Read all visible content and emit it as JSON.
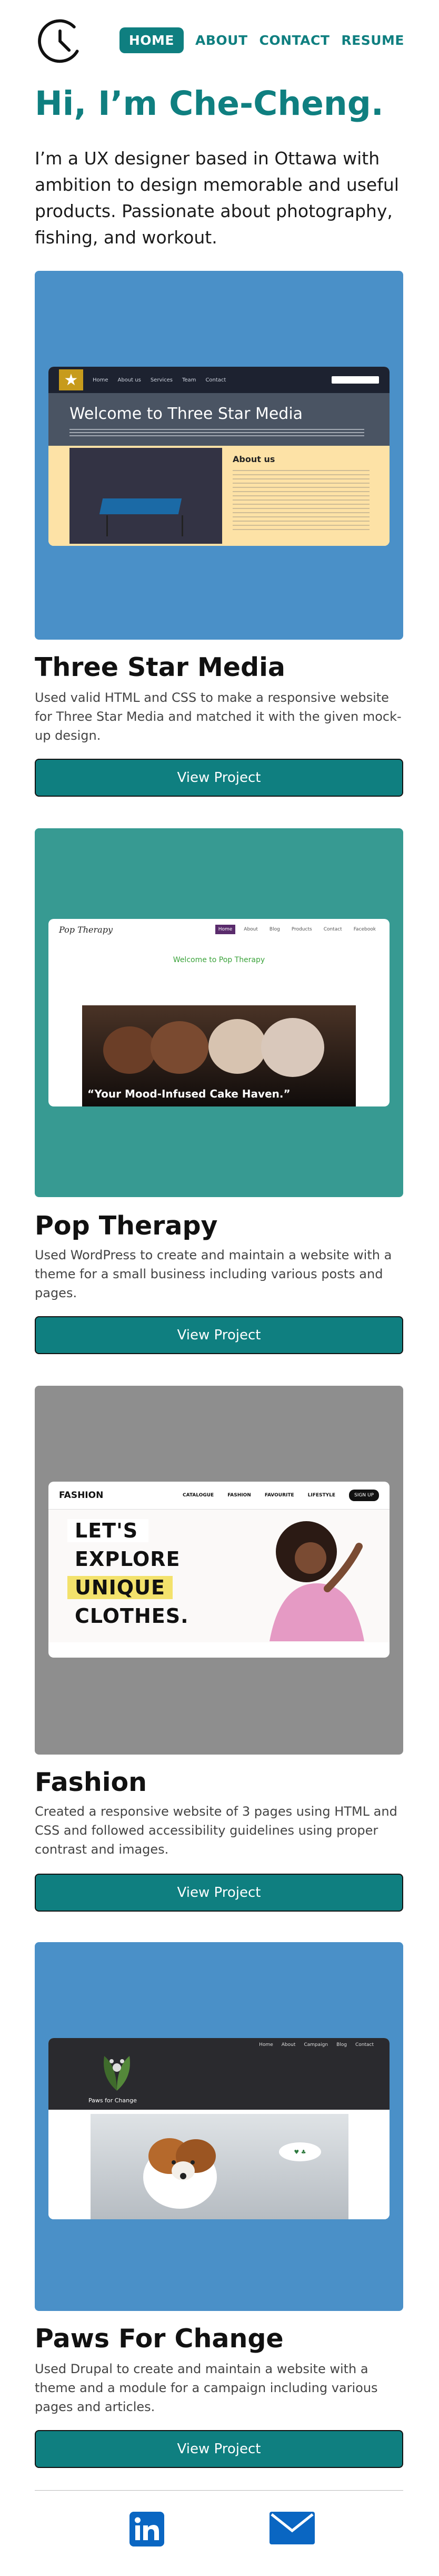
{
  "nav": {
    "items": [
      {
        "label": "HOME",
        "active": true
      },
      {
        "label": "ABOUT",
        "active": false
      },
      {
        "label": "CONTACT",
        "active": false
      },
      {
        "label": "RESUME",
        "active": false
      }
    ]
  },
  "hero": {
    "title": "Hi, I’m Che-Cheng.",
    "text": "I’m a UX designer based in Ottawa with ambition to design memorable and useful products. Passionate about photography, fishing, and workout."
  },
  "colors": {
    "accent": "#0f7f80",
    "card_blue": "#4a90c8",
    "card_teal": "#379a92",
    "card_gray": "#8e8e8e"
  },
  "projects": [
    {
      "title": "Three Star Media",
      "description": "Used valid HTML and CSS to make a responsive website for Three Star Media and matched it with the given mock-up design.",
      "button": "View Project",
      "mock": {
        "hero": "Welcome to Three Star Media",
        "about": "About us"
      }
    },
    {
      "title": "Pop Therapy",
      "description": "Used WordPress to create and maintain a website with a theme for a small business including various posts and pages.",
      "button": "View Project",
      "mock": {
        "brand": "Pop Therapy",
        "welcome": "Welcome to Pop Therapy",
        "quote": "“Your Mood-Infused Cake Haven.”"
      }
    },
    {
      "title": "Fashion",
      "description": "Created a responsive website of 3 pages using HTML and CSS and followed accessibility guidelines using proper contrast and images.",
      "button": "View Project",
      "mock": {
        "brand": "FASHION",
        "links": [
          "CATALOGUE",
          "FASHION",
          "FAVOURITE",
          "LIFESTYLE"
        ],
        "signup": "SIGN UP",
        "words": [
          "LET'S",
          "EXPLORE",
          "UNIQUE",
          "CLOTHES."
        ]
      }
    },
    {
      "title": "Paws For Change",
      "description": "Used Drupal to create and maintain a website with a theme and a module for a campaign including various pages and articles.",
      "button": "View Project",
      "mock": {
        "page_title": "Paws for Change"
      }
    }
  ],
  "footer": {
    "icons": [
      "linkedin-icon",
      "mail-icon"
    ]
  }
}
